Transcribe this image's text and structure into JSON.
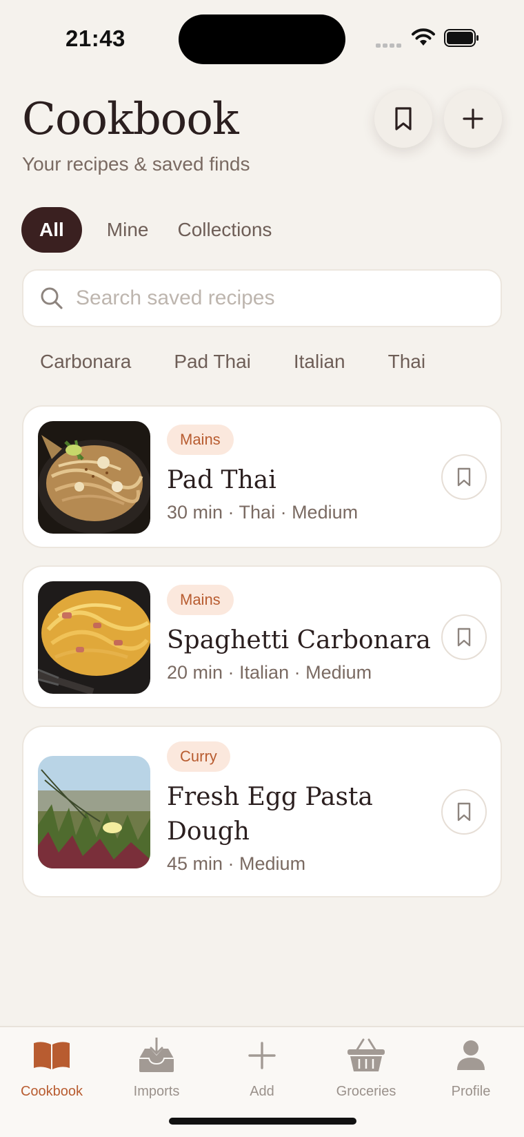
{
  "status": {
    "time": "21:43"
  },
  "header": {
    "title": "Cookbook",
    "subtitle": "Your recipes & saved finds"
  },
  "tabs": [
    {
      "label": "All",
      "active": true
    },
    {
      "label": "Mine",
      "active": false
    },
    {
      "label": "Collections",
      "active": false
    }
  ],
  "search": {
    "placeholder": "Search saved recipes",
    "value": ""
  },
  "chips": [
    "Carbonara",
    "Pad Thai",
    "Italian",
    "Thai"
  ],
  "recipes": [
    {
      "category": "Mains",
      "title": "Pad Thai",
      "meta": "30 min · Thai · Medium",
      "icon": "bookmark-icon"
    },
    {
      "category": "Mains",
      "title": "Spaghetti Carbonara",
      "meta": "20 min · Italian · Medium",
      "icon": "bookmark-icon"
    },
    {
      "category": "Curry",
      "title": "Fresh Egg Pasta Dough",
      "meta": "45 min · Medium",
      "icon": "bookmark-icon"
    }
  ],
  "tabbar": [
    {
      "label": "Cookbook",
      "icon": "book-icon",
      "active": true
    },
    {
      "label": "Imports",
      "icon": "inbox-download-icon",
      "active": false
    },
    {
      "label": "Add",
      "icon": "plus-icon",
      "active": false
    },
    {
      "label": "Groceries",
      "icon": "basket-icon",
      "active": false
    },
    {
      "label": "Profile",
      "icon": "person-icon",
      "active": false
    }
  ],
  "colors": {
    "accent": "#b85c30",
    "active_tab": "#3a2020",
    "background": "#f5f2ed",
    "badge_bg": "#fbe8dd"
  }
}
